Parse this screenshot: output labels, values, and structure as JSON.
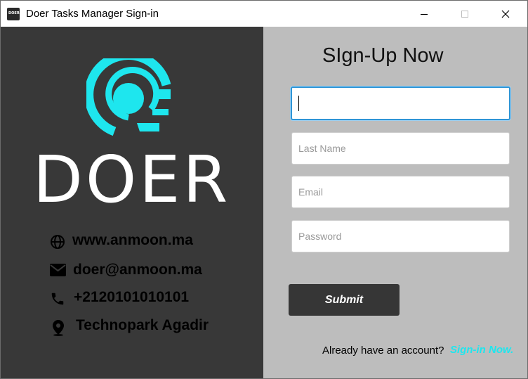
{
  "window": {
    "title": "Doer Tasks Manager Sign-in",
    "app_icon_text": "DOER",
    "controls": [
      "minimize-icon",
      "maximize-icon",
      "close-icon"
    ]
  },
  "brand": {
    "logo_text": "DOER",
    "accent_color": "#1ee6ee",
    "panel_color": "#383838"
  },
  "contacts": [
    {
      "icon": "globe-icon",
      "text": "www.anmoon.ma"
    },
    {
      "icon": "envelope-icon",
      "text": "doer@anmoon.ma"
    },
    {
      "icon": "phone-icon",
      "text": "+2120101010101"
    },
    {
      "icon": "map-pin-icon",
      "text": "Technopark Agadir"
    }
  ],
  "form": {
    "heading": "SIgn-Up Now",
    "first_name": {
      "value": "",
      "placeholder": ""
    },
    "last_name": {
      "value": "",
      "placeholder": "Last Name"
    },
    "email": {
      "value": "",
      "placeholder": "Email"
    },
    "password": {
      "value": "",
      "placeholder": "Password"
    },
    "submit_label": "Submit"
  },
  "footer": {
    "prompt": "Already have an account?",
    "link_label": "Sign-in Now."
  }
}
